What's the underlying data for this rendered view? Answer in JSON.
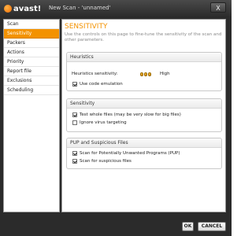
{
  "window": {
    "brand": "avast!",
    "title": "New Scan - 'unnamed'",
    "close_label": "X"
  },
  "sidebar": {
    "items": [
      {
        "label": "Scan",
        "active": false
      },
      {
        "label": "Sensitivity",
        "active": true
      },
      {
        "label": "Packers",
        "active": false
      },
      {
        "label": "Actions",
        "active": false
      },
      {
        "label": "Priority",
        "active": false
      },
      {
        "label": "Report file",
        "active": false
      },
      {
        "label": "Exclusions",
        "active": false
      },
      {
        "label": "Scheduling",
        "active": false
      }
    ]
  },
  "page": {
    "title": "SENSITIVITY",
    "description": "Use the controls on this page to fine-tune the sensitivity of the scan and other parameters."
  },
  "heuristics": {
    "header": "Heuristics",
    "sensitivity_label": "Heuristics sensitivity:",
    "sensitivity_value": "High",
    "use_code_emulation": {
      "label": "Use code emulation",
      "checked": true
    }
  },
  "sensitivity": {
    "header": "Sensitivity",
    "test_whole_files": {
      "label": "Test whole files (may be very slow for big files)",
      "checked": true
    },
    "ignore_virus_targeting": {
      "label": "Ignore virus targeting",
      "checked": false
    }
  },
  "pup": {
    "header": "PUP and Suspicious Files",
    "scan_pup": {
      "label": "Scan for Potentially Unwanted Programs (PUP)",
      "checked": true
    },
    "scan_suspicious": {
      "label": "Scan for suspicious files",
      "checked": true
    }
  },
  "buttons": {
    "ok": "OK",
    "cancel": "CANCEL"
  },
  "colors": {
    "accent": "#f39200",
    "titlebar": "#2b2b2b"
  }
}
